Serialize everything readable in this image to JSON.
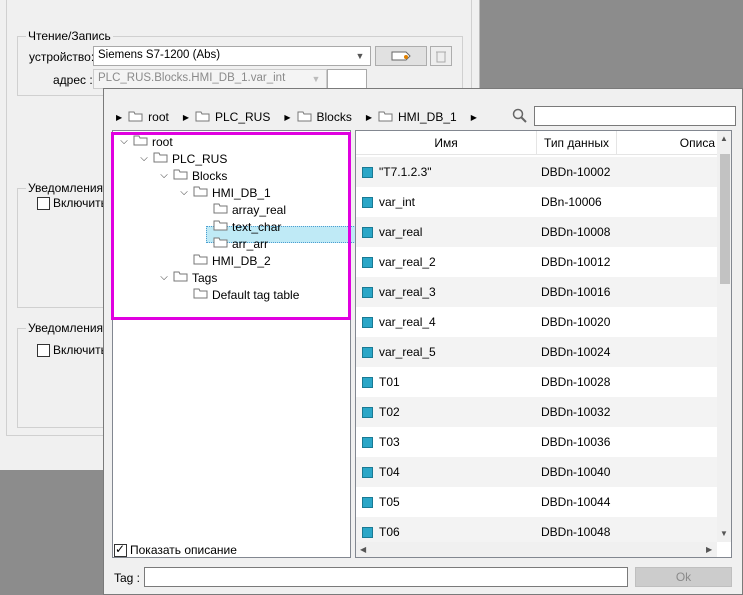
{
  "bg": {
    "rw_group": "Чтение/Запись",
    "device_label": "устройство:",
    "device_value": "Siemens S7-1200 (Abs)",
    "address_label": "адрес :",
    "address_value": "PLC_RUS.Blocks.HMI_DB_1.var_int",
    "notify_group": "Уведомления",
    "notify_check": "Включить",
    "notify2_group": "Уведомления о",
    "notify2_check": "Включить"
  },
  "breadcrumb": [
    "root",
    "PLC_RUS",
    "Blocks",
    "HMI_DB_1"
  ],
  "tree": [
    {
      "label": "root",
      "level": 0,
      "expanded": true
    },
    {
      "label": "PLC_RUS",
      "level": 1,
      "expanded": true
    },
    {
      "label": "Blocks",
      "level": 2,
      "expanded": true
    },
    {
      "label": "HMI_DB_1",
      "level": 3,
      "expanded": true,
      "selected": true
    },
    {
      "label": "array_real",
      "level": 4
    },
    {
      "label": "text_char",
      "level": 4
    },
    {
      "label": "arr_arr",
      "level": 4
    },
    {
      "label": "HMI_DB_2",
      "level": 3
    },
    {
      "label": "Tags",
      "level": 2,
      "expanded": true
    },
    {
      "label": "Default tag table",
      "level": 3
    }
  ],
  "list": {
    "headers": {
      "name": "Имя",
      "type": "Тип данных",
      "desc": "Описа"
    },
    "rows": [
      {
        "name": "\"T7.1.2.3\"",
        "type": "DBDn-10002"
      },
      {
        "name": "var_int",
        "type": "DBn-10006"
      },
      {
        "name": "var_real",
        "type": "DBDn-10008"
      },
      {
        "name": "var_real_2",
        "type": "DBDn-10012"
      },
      {
        "name": "var_real_3",
        "type": "DBDn-10016"
      },
      {
        "name": "var_real_4",
        "type": "DBDn-10020"
      },
      {
        "name": "var_real_5",
        "type": "DBDn-10024"
      },
      {
        "name": "T01",
        "type": "DBDn-10028"
      },
      {
        "name": "T02",
        "type": "DBDn-10032"
      },
      {
        "name": "T03",
        "type": "DBDn-10036"
      },
      {
        "name": "T04",
        "type": "DBDn-10040"
      },
      {
        "name": "T05",
        "type": "DBDn-10044"
      },
      {
        "name": "T06",
        "type": "DBDn-10048"
      }
    ]
  },
  "footer": {
    "show_desc": "Показать описание",
    "tag_label": "Tag :",
    "ok": "Ok"
  },
  "colors": {
    "highlight": "#e000e0",
    "tag_icon": "#2aa6c7",
    "selection": "#bfeaf6"
  }
}
